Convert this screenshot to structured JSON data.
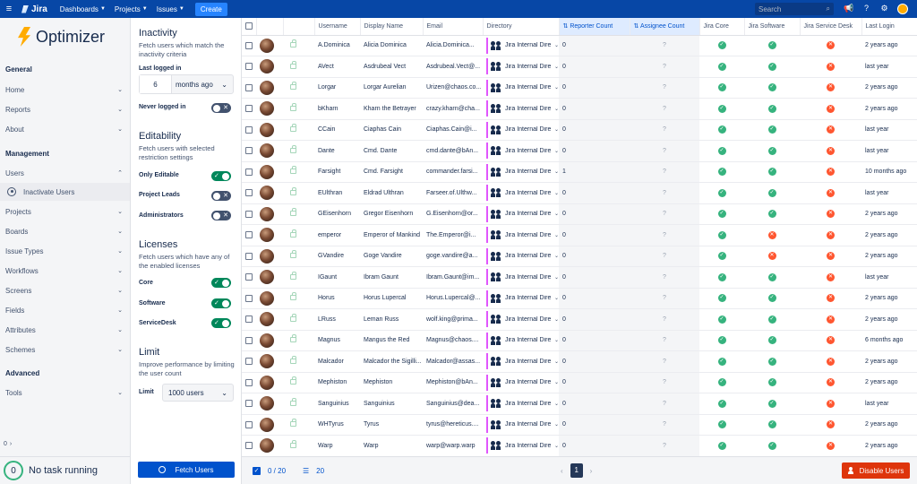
{
  "topnav": {
    "app_name": "Jira",
    "menus": [
      "Dashboards",
      "Projects",
      "Issues"
    ],
    "create_label": "Create",
    "search_placeholder": "Search"
  },
  "sidebar": {
    "brand": "Optimizer",
    "general_title": "General",
    "general_items": [
      "Home",
      "Reports",
      "About"
    ],
    "management_title": "Management",
    "users_label": "Users",
    "inactivate_label": "Inactivate Users",
    "management_items": [
      "Projects",
      "Boards",
      "Issue Types",
      "Workflows",
      "Screens",
      "Fields",
      "Attributes",
      "Schemes"
    ],
    "advanced_title": "Advanced",
    "tools_label": "Tools",
    "collapse_count": "0",
    "task_count": "0",
    "task_text": "No task running"
  },
  "filters": {
    "inactivity": {
      "title": "Inactivity",
      "desc": "Fetch users which match the inactivity criteria",
      "last_logged_label": "Last logged in",
      "last_logged_value": "6",
      "last_logged_unit": "months ago",
      "never_logged_label": "Never logged in",
      "never_logged_on": false
    },
    "editability": {
      "title": "Editability",
      "desc": "Fetch users with selected restriction settings",
      "only_editable_label": "Only Editable",
      "only_editable_on": true,
      "project_leads_label": "Project Leads",
      "project_leads_on": false,
      "administrators_label": "Administrators",
      "administrators_on": false
    },
    "licenses": {
      "title": "Licenses",
      "desc": "Fetch users which have any of the enabled licenses",
      "core_label": "Core",
      "core_on": true,
      "software_label": "Software",
      "software_on": true,
      "servicedesk_label": "ServiceDesk",
      "servicedesk_on": true
    },
    "limit": {
      "title": "Limit",
      "desc": "Improve performance by limiting the user count",
      "label": "Limit",
      "value": "1000 users"
    },
    "fetch_label": "Fetch Users"
  },
  "table": {
    "headers": [
      "Username",
      "Display Name",
      "Email",
      "Directory",
      "Reporter Count",
      "Assignee Count",
      "Jira Core",
      "Jira Software",
      "Jira Service Desk",
      "Last Login"
    ],
    "directory_label": "Jira Internal Dire",
    "assignee_placeholder": "?",
    "rows": [
      {
        "username": "A.Dominica",
        "display": "Alicia Dominica",
        "email": "Alicia.Dominica...",
        "reporter": "0",
        "core": true,
        "software": true,
        "servicedesk": false,
        "login": "2 years ago"
      },
      {
        "username": "AVect",
        "display": "Asdrubeal Vect",
        "email": "Asdrubeal.Vect@...",
        "reporter": "0",
        "core": true,
        "software": true,
        "servicedesk": false,
        "login": "last year"
      },
      {
        "username": "Lorgar",
        "display": "Lorgar Aurelian",
        "email": "Urizen@chaos.co...",
        "reporter": "0",
        "core": true,
        "software": true,
        "servicedesk": false,
        "login": "2 years ago"
      },
      {
        "username": "bKharn",
        "display": "Kharn the Betrayer",
        "email": "crazy.kharn@cha...",
        "reporter": "0",
        "core": true,
        "software": true,
        "servicedesk": false,
        "login": "2 years ago"
      },
      {
        "username": "CCain",
        "display": "Ciaphas Cain",
        "email": "Ciaphas.Cain@i...",
        "reporter": "0",
        "core": true,
        "software": true,
        "servicedesk": false,
        "login": "last year"
      },
      {
        "username": "Dante",
        "display": "Cmd. Dante",
        "email": "cmd.dante@bAn...",
        "reporter": "0",
        "core": true,
        "software": true,
        "servicedesk": false,
        "login": "last year"
      },
      {
        "username": "Farsight",
        "display": "Cmd. Farsight",
        "email": "commander.farsi...",
        "reporter": "1",
        "core": true,
        "software": true,
        "servicedesk": false,
        "login": "10 months ago"
      },
      {
        "username": "EUlthran",
        "display": "Eldrad Ulthran",
        "email": "Farseer.of.Ulthw...",
        "reporter": "0",
        "core": true,
        "software": true,
        "servicedesk": false,
        "login": "last year"
      },
      {
        "username": "GEisenhorn",
        "display": "Gregor Eisenhorn",
        "email": "G.Eisenhorn@or...",
        "reporter": "0",
        "core": true,
        "software": true,
        "servicedesk": false,
        "login": "2 years ago"
      },
      {
        "username": "emperor",
        "display": "Emperor of Mankind",
        "email": "The.Emperor@i...",
        "reporter": "0",
        "core": true,
        "software": false,
        "servicedesk": false,
        "login": "2 years ago"
      },
      {
        "username": "GVandire",
        "display": "Goge Vandire",
        "email": "goge.vandire@a...",
        "reporter": "0",
        "core": true,
        "software": false,
        "servicedesk": false,
        "login": "2 years ago"
      },
      {
        "username": "IGaunt",
        "display": "Ibram Gaunt",
        "email": "Ibram.Gaunt@im...",
        "reporter": "0",
        "core": true,
        "software": true,
        "servicedesk": false,
        "login": "last year"
      },
      {
        "username": "Horus",
        "display": "Horus Lupercal",
        "email": "Horus.Lupercal@...",
        "reporter": "0",
        "core": true,
        "software": true,
        "servicedesk": false,
        "login": "2 years ago"
      },
      {
        "username": "LRuss",
        "display": "Leman Russ",
        "email": "wolf.king@prima...",
        "reporter": "0",
        "core": true,
        "software": true,
        "servicedesk": false,
        "login": "2 years ago"
      },
      {
        "username": "Magnus",
        "display": "Mangus the Red",
        "email": "Magnus@chaos....",
        "reporter": "0",
        "core": true,
        "software": true,
        "servicedesk": false,
        "login": "6 months ago"
      },
      {
        "username": "Malcador",
        "display": "Malcador the Sigilli...",
        "email": "Malcador@assas...",
        "reporter": "0",
        "core": true,
        "software": true,
        "servicedesk": false,
        "login": "2 years ago"
      },
      {
        "username": "Mephiston",
        "display": "Mephiston",
        "email": "Mephiston@bAn...",
        "reporter": "0",
        "core": true,
        "software": true,
        "servicedesk": false,
        "login": "2 years ago"
      },
      {
        "username": "Sanguinius",
        "display": "Sanguinius",
        "email": "Sanguinius@dea...",
        "reporter": "0",
        "core": true,
        "software": true,
        "servicedesk": false,
        "login": "last year"
      },
      {
        "username": "WHTyrus",
        "display": "Tyrus",
        "email": "tyrus@hereticus....",
        "reporter": "0",
        "core": true,
        "software": true,
        "servicedesk": false,
        "login": "2 years ago"
      },
      {
        "username": "Warp",
        "display": "Warp",
        "email": "warp@warp.warp",
        "reporter": "0",
        "core": true,
        "software": true,
        "servicedesk": false,
        "login": "2 years ago"
      }
    ]
  },
  "bottombar": {
    "selected": "0 / 20",
    "count": "20",
    "page": "1",
    "disable_label": "Disable Users"
  }
}
